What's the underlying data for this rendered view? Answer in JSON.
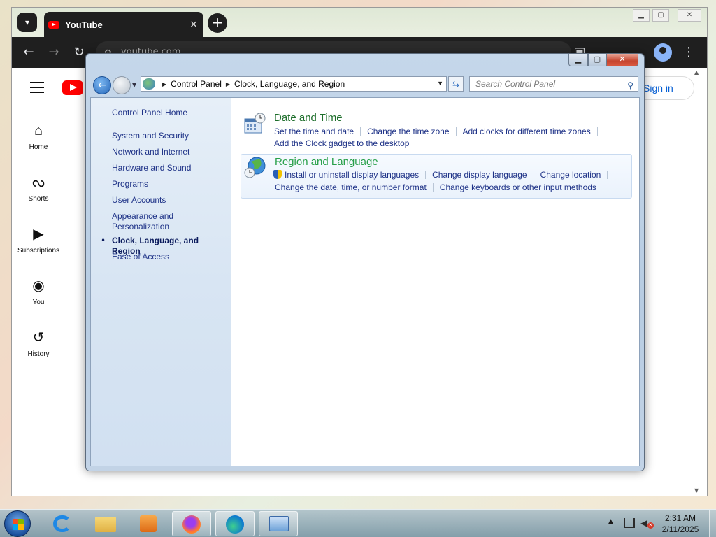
{
  "browser": {
    "tab_title": "YouTube",
    "tab_close": "×",
    "new_tab": "+",
    "address": "youtube.com",
    "back_icon": "←",
    "forward_icon": "→",
    "reload_icon": "↻",
    "menu_icon": "⋮"
  },
  "youtube": {
    "nav": [
      {
        "label": "Home",
        "icon": "home-icon"
      },
      {
        "label": "Shorts",
        "icon": "shorts-icon"
      },
      {
        "label": "Subscriptions",
        "icon": "subscriptions-icon"
      },
      {
        "label": "You",
        "icon": "you-icon"
      },
      {
        "label": "History",
        "icon": "history-icon"
      }
    ],
    "sign_in": "Sign in"
  },
  "control_panel": {
    "breadcrumb": [
      "Control Panel",
      "Clock, Language, and Region"
    ],
    "search_placeholder": "Search Control Panel",
    "nav": {
      "home": "Control Panel Home",
      "items": [
        "System and Security",
        "Network and Internet",
        "Hardware and Sound",
        "Programs",
        "User Accounts",
        "Appearance and Personalization",
        "Clock, Language, and Region",
        "Ease of Access"
      ],
      "selected": "Clock, Language, and Region"
    },
    "categories": {
      "date_time": {
        "title": "Date and Time",
        "links": [
          "Set the time and date",
          "Change the time zone",
          "Add clocks for different time zones",
          "Add the Clock gadget to the desktop"
        ]
      },
      "region": {
        "title": "Region and Language",
        "links": [
          "Install or uninstall display languages",
          "Change display language",
          "Change location",
          "Change the date, time, or number format",
          "Change keyboards or other input methods"
        ]
      }
    }
  },
  "taskbar": {
    "time": "2:31 AM",
    "date": "2/11/2025"
  },
  "colors": {
    "youtube_red": "#ff0000",
    "link_blue": "#1e3287",
    "category_green": "#1e6e2b"
  }
}
